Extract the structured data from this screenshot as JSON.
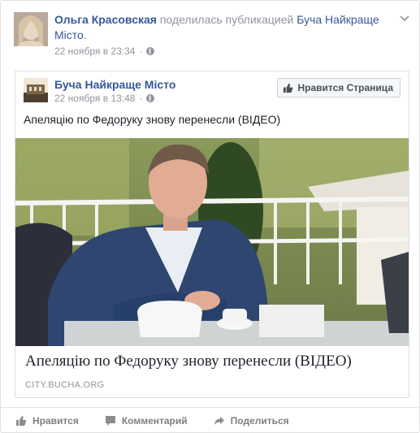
{
  "post": {
    "author": "Ольга Красовская",
    "action_text": "поделилась публикацией",
    "shared_page": "Буча Найкраще Місто",
    "shared_page_suffix": ".",
    "timestamp": "22 ноября в 23:34",
    "privacy_icon": "globe-icon"
  },
  "shared": {
    "page_name": "Буча Найкраще Місто",
    "timestamp": "22 ноября в 13:48",
    "like_page_label": "Нравится Страница",
    "text": "Апеляцію по Федоруку знову перенесли (ВІДЕО)",
    "link_title": "Апеляцію по Федоруку знову перенесли (ВІДЕО)",
    "link_domain": "CITY.BUCHA.ORG"
  },
  "actions": {
    "like": "Нравится",
    "comment": "Комментарий",
    "share": "Поделиться"
  },
  "colors": {
    "link": "#365899",
    "meta": "#90949c",
    "text": "#1d2129"
  }
}
